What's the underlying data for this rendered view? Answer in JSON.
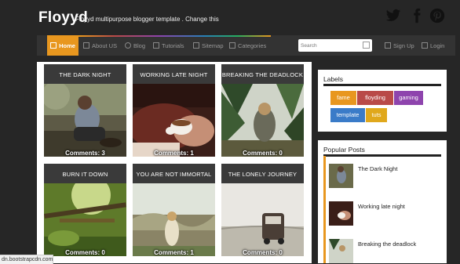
{
  "header": {
    "brand": "Floyyd",
    "tagline": "Floyyd multipurpose blogger template . Change this"
  },
  "social": {
    "twitter_icon": "twitter-icon",
    "facebook_icon": "facebook-icon",
    "pinterest_icon": "pinterest-icon"
  },
  "nav": {
    "items": [
      {
        "label": "Home",
        "active": true
      },
      {
        "label": "About US"
      },
      {
        "label": "Blog"
      },
      {
        "label": "Tutorials"
      },
      {
        "label": "Sitemap"
      },
      {
        "label": "Categories"
      }
    ],
    "search_placeholder": "Search",
    "signup": "Sign Up",
    "login": "Login"
  },
  "posts": [
    {
      "title": "THE DARK NIGHT",
      "comments": "Comments: 3"
    },
    {
      "title": "WORKING LATE NIGHT",
      "comments": "Comments: 1"
    },
    {
      "title": "BREAKING THE DEADLOCK",
      "comments": "Comments: 0"
    },
    {
      "title": "BURN IT DOWN",
      "comments": "Comments: 0"
    },
    {
      "title": "YOU ARE NOT IMMORTAL",
      "comments": "Comments: 1"
    },
    {
      "title": "THE LONELY JOURNEY",
      "comments": "Comments: 0"
    }
  ],
  "sidebar": {
    "labels_title": "Labels",
    "tags": [
      {
        "label": "fame",
        "color": "#e8971f"
      },
      {
        "label": "floyding",
        "color": "#b94a48"
      },
      {
        "label": "gaming",
        "color": "#8e44ad"
      },
      {
        "label": "template",
        "color": "#3a7bc8"
      },
      {
        "label": "tuts",
        "color": "#e0a81c"
      }
    ],
    "popular_title": "Popular Posts",
    "popular": [
      {
        "title": "The Dark Night"
      },
      {
        "title": "Working late night"
      },
      {
        "title": "Breaking the deadlock"
      }
    ]
  },
  "status": {
    "url": "dn.bootstrapcdn.com"
  },
  "colors": {
    "accent": "#e8971f",
    "nav_bg": "#333333",
    "page_bg": "#262626"
  }
}
